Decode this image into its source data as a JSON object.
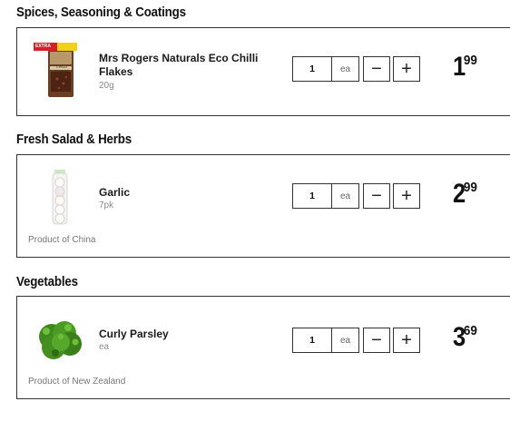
{
  "sections": [
    {
      "title": "Spices, Seasoning & Coatings",
      "item": {
        "name": "Mrs Rogers Naturals Eco Chilli Flakes",
        "size": "20g",
        "origin": "",
        "qty": "1",
        "unit": "ea",
        "price_dollars": "1",
        "price_cents": "99",
        "badge": "EXTRA",
        "pack_label": "CHILLI FLAKES"
      }
    },
    {
      "title": "Fresh Salad & Herbs",
      "item": {
        "name": "Garlic",
        "size": "7pk",
        "origin": "Product of China",
        "qty": "1",
        "unit": "ea",
        "price_dollars": "2",
        "price_cents": "99"
      }
    },
    {
      "title": "Vegetables",
      "item": {
        "name": "Curly Parsley",
        "size": "ea",
        "origin": "Product of New Zealand",
        "qty": "1",
        "unit": "ea",
        "price_dollars": "3",
        "price_cents": "69"
      }
    }
  ],
  "controls": {
    "minus": "−",
    "plus": "+"
  },
  "colors": {
    "badge_red": "#d6202a",
    "badge_yellow": "#f2d11a",
    "parsley_green": "#3f8a1e"
  }
}
